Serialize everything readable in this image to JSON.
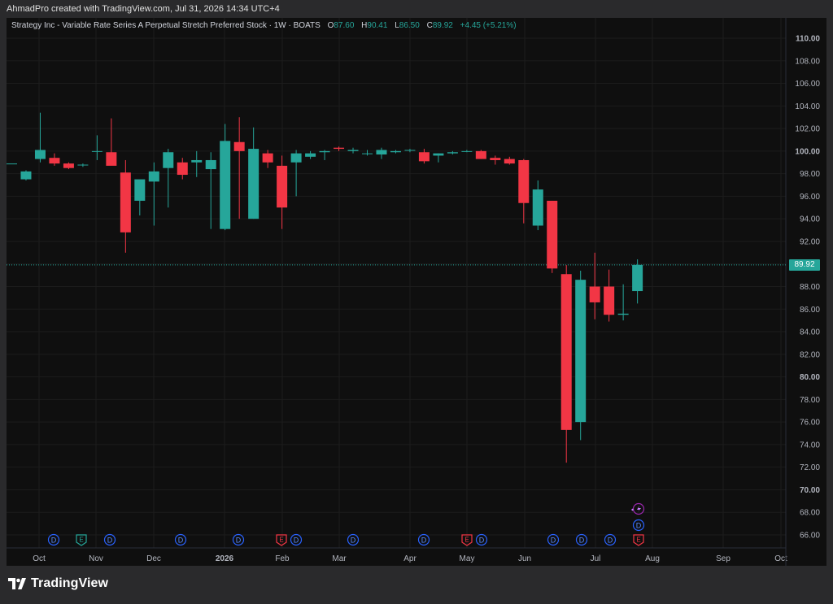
{
  "header": {
    "credit": "AhmadPro created with TradingView.com, Jul 31, 2026 14:34 UTC+4"
  },
  "legend": {
    "title": "Strategy Inc - Variable Rate Series A Perpetual Stretch Preferred Stock · 1W · BOATS",
    "open_label": "O",
    "open": "87.60",
    "high_label": "H",
    "high": "90.41",
    "low_label": "L",
    "low": "86.50",
    "close_label": "C",
    "close": "89.92",
    "change": "+4.45 (+5.21%)"
  },
  "price_label": "89.92",
  "footer": {
    "brand": "TradingView"
  },
  "colors": {
    "up": "#26a69a",
    "down": "#f23645",
    "background": "#0f0f0f",
    "event_blue": "#2962ff",
    "event_green": "#26a69a",
    "event_red": "#f23645",
    "event_purple": "#9c27b0"
  },
  "chart_data": {
    "type": "candlestick",
    "interval": "1W",
    "ylim": [
      65,
      111
    ],
    "y_ticks": [
      "110.00",
      "108.00",
      "106.00",
      "104.00",
      "102.00",
      "100.00",
      "98.00",
      "96.00",
      "94.00",
      "92.00",
      "90.00",
      "88.00",
      "86.00",
      "84.00",
      "82.00",
      "80.00",
      "78.00",
      "76.00",
      "74.00",
      "72.00",
      "70.00",
      "68.00",
      "66.00"
    ],
    "x_ticks": [
      "Oct",
      "Nov",
      "Dec",
      "2026",
      "Feb",
      "Mar",
      "Apr",
      "May",
      "Jun",
      "Jul",
      "Aug",
      "Sep",
      "Oct"
    ],
    "last_close": 89.92,
    "candles": [
      {
        "o": 98.9,
        "h": 98.9,
        "l": 98.9,
        "c": 98.9
      },
      {
        "o": 97.5,
        "h": 98.3,
        "l": 97.4,
        "c": 98.2
      },
      {
        "o": 99.3,
        "h": 103.4,
        "l": 99.0,
        "c": 100.1
      },
      {
        "o": 99.4,
        "h": 99.8,
        "l": 98.7,
        "c": 98.9
      },
      {
        "o": 98.9,
        "h": 99.0,
        "l": 98.4,
        "c": 98.5
      },
      {
        "o": 98.8,
        "h": 98.9,
        "l": 98.6,
        "c": 98.8
      },
      {
        "o": 100.0,
        "h": 101.4,
        "l": 99.2,
        "c": 100.0
      },
      {
        "o": 99.9,
        "h": 102.9,
        "l": 98.9,
        "c": 98.7
      },
      {
        "o": 98.1,
        "h": 99.2,
        "l": 91.0,
        "c": 92.8
      },
      {
        "o": 95.6,
        "h": 97.2,
        "l": 94.3,
        "c": 97.5
      },
      {
        "o": 97.3,
        "h": 99.0,
        "l": 93.4,
        "c": 98.2
      },
      {
        "o": 98.5,
        "h": 100.2,
        "l": 95.0,
        "c": 99.9
      },
      {
        "o": 99.0,
        "h": 99.4,
        "l": 97.5,
        "c": 97.9
      },
      {
        "o": 99.0,
        "h": 100.0,
        "l": 97.7,
        "c": 99.2
      },
      {
        "o": 98.4,
        "h": 99.9,
        "l": 93.1,
        "c": 99.2
      },
      {
        "o": 93.1,
        "h": 102.4,
        "l": 93.0,
        "c": 100.9
      },
      {
        "o": 100.8,
        "h": 103.0,
        "l": 94.0,
        "c": 100.0
      },
      {
        "o": 94.0,
        "h": 102.1,
        "l": 94.0,
        "c": 100.2
      },
      {
        "o": 99.8,
        "h": 100.1,
        "l": 98.5,
        "c": 99.0
      },
      {
        "o": 98.7,
        "h": 99.6,
        "l": 93.1,
        "c": 95.0
      },
      {
        "o": 99.0,
        "h": 100.1,
        "l": 96.0,
        "c": 99.8
      },
      {
        "o": 99.5,
        "h": 100.0,
        "l": 99.3,
        "c": 99.8
      },
      {
        "o": 99.9,
        "h": 100.1,
        "l": 99.2,
        "c": 100.0
      },
      {
        "o": 100.3,
        "h": 100.4,
        "l": 100.0,
        "c": 100.2
      },
      {
        "o": 100.0,
        "h": 100.3,
        "l": 99.8,
        "c": 100.1
      },
      {
        "o": 99.8,
        "h": 100.1,
        "l": 99.6,
        "c": 99.8
      },
      {
        "o": 99.7,
        "h": 100.3,
        "l": 99.3,
        "c": 100.1
      },
      {
        "o": 99.9,
        "h": 100.1,
        "l": 99.8,
        "c": 100.0
      },
      {
        "o": 100.1,
        "h": 100.2,
        "l": 99.9,
        "c": 100.1
      },
      {
        "o": 99.9,
        "h": 100.2,
        "l": 98.9,
        "c": 99.1
      },
      {
        "o": 99.6,
        "h": 99.8,
        "l": 99.0,
        "c": 99.8
      },
      {
        "o": 99.8,
        "h": 100.0,
        "l": 99.7,
        "c": 99.9
      },
      {
        "o": 100.0,
        "h": 100.1,
        "l": 99.9,
        "c": 100.0
      },
      {
        "o": 100.0,
        "h": 100.1,
        "l": 99.3,
        "c": 99.3
      },
      {
        "o": 99.4,
        "h": 99.6,
        "l": 98.8,
        "c": 99.2
      },
      {
        "o": 99.3,
        "h": 99.5,
        "l": 98.8,
        "c": 98.9
      },
      {
        "o": 99.2,
        "h": 99.3,
        "l": 93.6,
        "c": 95.4
      },
      {
        "o": 93.4,
        "h": 97.4,
        "l": 93.0,
        "c": 96.6
      },
      {
        "o": 95.6,
        "h": 95.6,
        "l": 89.2,
        "c": 89.6
      },
      {
        "o": 89.1,
        "h": 89.9,
        "l": 72.4,
        "c": 75.3
      },
      {
        "o": 76.0,
        "h": 89.4,
        "l": 74.4,
        "c": 88.6
      },
      {
        "o": 88.0,
        "h": 91.0,
        "l": 85.1,
        "c": 86.6
      },
      {
        "o": 88.0,
        "h": 89.5,
        "l": 84.9,
        "c": 85.5
      },
      {
        "o": 85.5,
        "h": 88.2,
        "l": 85.0,
        "c": 85.6
      },
      {
        "o": 87.6,
        "h": 90.41,
        "l": 86.5,
        "c": 89.92
      }
    ],
    "event_markers": [
      {
        "type": "D",
        "row": 1,
        "at": "Oct"
      },
      {
        "type": "E",
        "row": 1,
        "at": "Nov-"
      },
      {
        "type": "D",
        "row": 1,
        "at": "Nov"
      },
      {
        "type": "D",
        "row": 1,
        "at": "Dec"
      },
      {
        "type": "D",
        "row": 1,
        "at": "2026"
      },
      {
        "type": "E",
        "row": 1,
        "at": "Feb"
      },
      {
        "type": "D",
        "row": 1,
        "at": "Feb"
      },
      {
        "type": "D",
        "row": 1,
        "at": "Mar"
      },
      {
        "type": "D",
        "row": 1,
        "at": "Apr"
      },
      {
        "type": "E",
        "row": 1,
        "at": "May"
      },
      {
        "type": "D",
        "row": 1,
        "at": "May"
      },
      {
        "type": "D",
        "row": 1,
        "at": "Jun"
      },
      {
        "type": "D",
        "row": 1,
        "at": "Jul"
      },
      {
        "type": "D",
        "row": 1,
        "at": "Jul"
      },
      {
        "type": "E",
        "row": 1,
        "at": "Aug"
      },
      {
        "type": "D",
        "row": 2,
        "at": "Aug"
      },
      {
        "type": "S",
        "row": 3,
        "at": "Aug"
      }
    ]
  }
}
